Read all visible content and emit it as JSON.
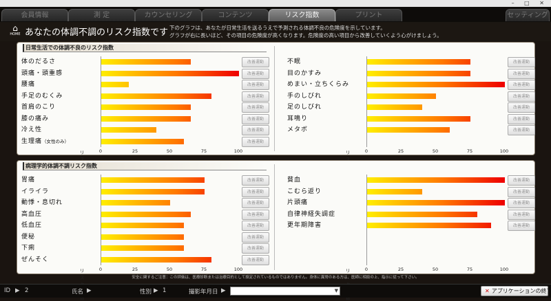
{
  "window": {
    "controls": "– □ ✕"
  },
  "tabs": [
    {
      "label": "会員情報",
      "active": false
    },
    {
      "label": "測 定",
      "active": false
    },
    {
      "label": "カウンセリング",
      "active": false
    },
    {
      "label": "コンテンツ",
      "active": false
    },
    {
      "label": "リスク指数",
      "active": true
    },
    {
      "label": "プリント",
      "active": false
    },
    {
      "label": "セッティング",
      "active": false
    }
  ],
  "header": {
    "home_label": "HOME",
    "title": "あなたの体調不調のリスク指数です",
    "desc_line1": "下のグラフは、あなたが日常生活を送るうえで予測される体調不良の危険度を示しています。",
    "desc_line2": "グラフが右に長いほど、その項目の危険度が高くなります。危険度の高い項目から改善していくよう心がけましょう。"
  },
  "axis": {
    "label": "リスク指数",
    "ticks": [
      "0",
      "25",
      "50",
      "75",
      "100"
    ],
    "range": [
      0,
      100
    ]
  },
  "improve_button_label": "改善運動",
  "sections": [
    {
      "title": "日常生活での体調不良のリスク指数",
      "columns": [
        [
          {
            "label": "体のだるさ",
            "value": 65
          },
          {
            "label": "頭痛・頭重感",
            "value": 100
          },
          {
            "label": "腰痛",
            "value": 20
          },
          {
            "label": "手足のむくみ",
            "value": 80
          },
          {
            "label": "首肩のこり",
            "value": 65
          },
          {
            "label": "膝の痛み",
            "value": 65
          },
          {
            "label": "冷え性",
            "value": 40
          },
          {
            "label": "生理痛",
            "note": "（女性のみ）",
            "value": 60
          }
        ],
        [
          {
            "label": "不眠",
            "value": 75
          },
          {
            "label": "目のかすみ",
            "value": 75
          },
          {
            "label": "めまい・立ちくらみ",
            "value": 100
          },
          {
            "label": "手のしびれ",
            "value": 50
          },
          {
            "label": "足のしびれ",
            "value": 40
          },
          {
            "label": "耳鳴り",
            "value": 75
          },
          {
            "label": "メタボ",
            "value": 60
          }
        ]
      ]
    },
    {
      "title": "病理学的体調不調リスク指数",
      "columns": [
        [
          {
            "label": "胃痛",
            "value": 75
          },
          {
            "label": "イライラ",
            "value": 75
          },
          {
            "label": "動悸・息切れ",
            "value": 50
          },
          {
            "label": "高血圧",
            "value": 65
          },
          {
            "label": "低血圧",
            "value": 60
          },
          {
            "label": "便秘",
            "value": 60
          },
          {
            "label": "下痢",
            "value": 60
          },
          {
            "label": "ぜんそく",
            "value": 80
          }
        ],
        [
          {
            "label": "貧血",
            "value": 100
          },
          {
            "label": "こむら返り",
            "value": 40
          },
          {
            "label": "片頭痛",
            "value": 100
          },
          {
            "label": "自律神経失調症",
            "value": 80
          },
          {
            "label": "更年期障害",
            "value": 90
          }
        ]
      ]
    }
  ],
  "footnote": "安全に関するご注意：この評価は、医療診断または治療目的として設定されているものではありません。身体に異常のある方は、医師に相談の上、指示に従って下さい。",
  "status": {
    "id_label": "ID",
    "id_value": "2",
    "name_label": "氏名",
    "name_value": "",
    "gender_label": "性別",
    "gender_value": "1",
    "date_label": "撮影年月日",
    "date_value": "",
    "exit_label": "アプリケーションの終了"
  }
}
